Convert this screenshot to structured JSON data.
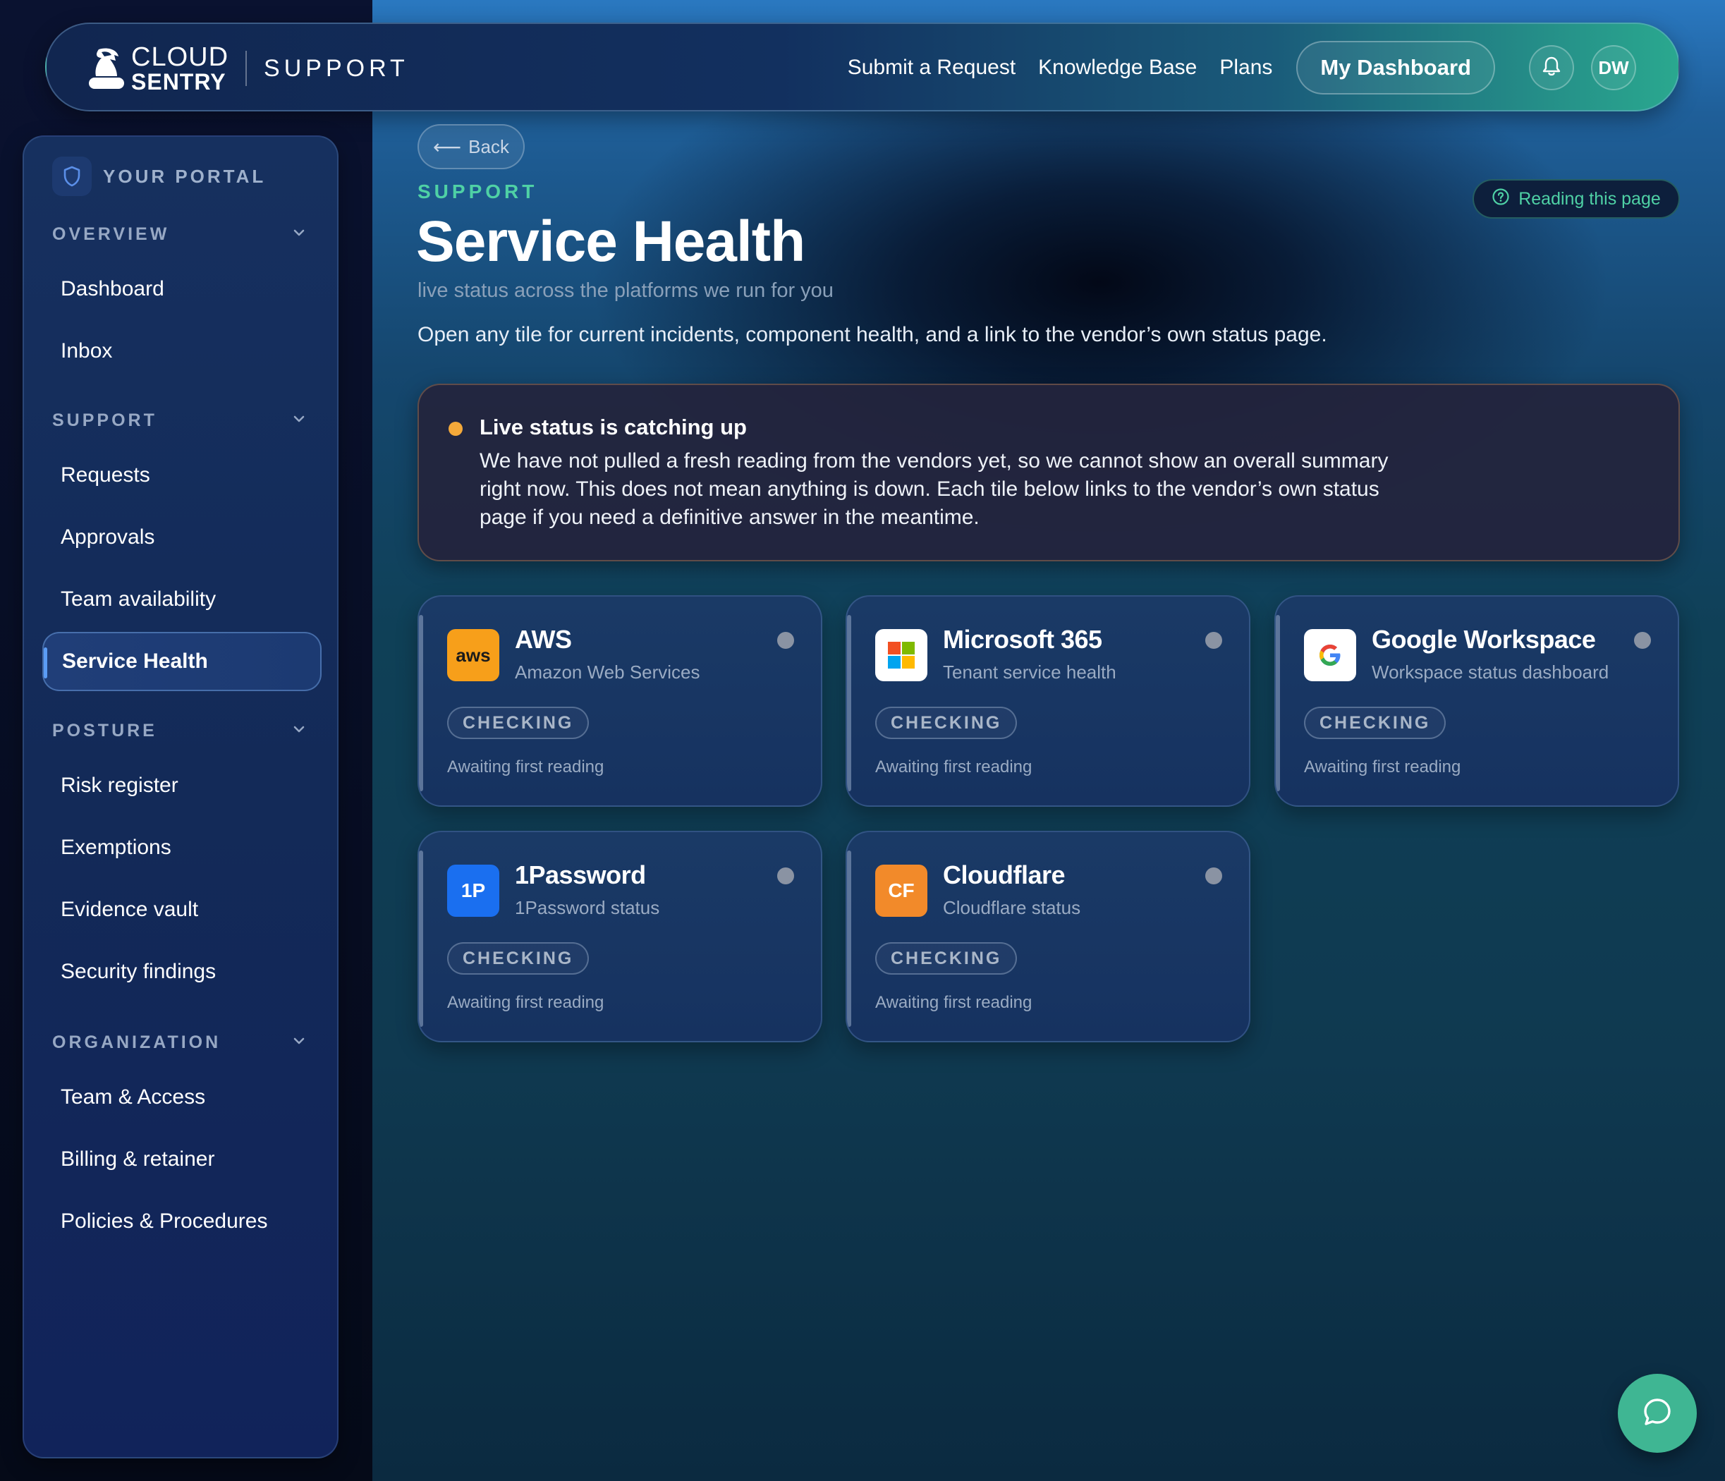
{
  "brand": {
    "name_line1": "CLOUD",
    "name_line2": "SENTRY",
    "section": "SUPPORT",
    "icon": "knight-helmet-icon"
  },
  "topnav": {
    "links": [
      "Submit a Request",
      "Knowledge Base",
      "Plans"
    ],
    "dashboard_button": "My Dashboard",
    "bell_icon": "bell-icon",
    "avatar_initials": "DW"
  },
  "sidebar": {
    "portal_label": "YOUR PORTAL",
    "portal_icon": "shield-icon",
    "sections": [
      {
        "label": "OVERVIEW",
        "items": [
          "Dashboard",
          "Inbox"
        ]
      },
      {
        "label": "SUPPORT",
        "items": [
          "Requests",
          "Approvals",
          "Team availability",
          "Service Health"
        ]
      },
      {
        "label": "POSTURE",
        "items": [
          "Risk register",
          "Exemptions",
          "Evidence vault",
          "Security findings"
        ]
      },
      {
        "label": "ORGANIZATION",
        "items": [
          "Team & Access",
          "Billing & retainer",
          "Policies & Procedures"
        ]
      }
    ],
    "active_item": "Service Health"
  },
  "main": {
    "back_label": "Back",
    "eyebrow": "SUPPORT",
    "title": "Service Health",
    "subtitle": "live status across the platforms we run for you",
    "description": "Open any tile for current incidents, component health, and a link to the vendor’s own status page.",
    "reading_button": "Reading this page"
  },
  "alert": {
    "title": "Live status is catching up",
    "body": "We have not pulled a fresh reading from the vendors yet, so we cannot show an overall summary right now. This does not mean anything is down. Each tile below links to the vendor’s own status page if you need a definitive answer in the meantime.",
    "color": "#f4a93a"
  },
  "tiles": [
    {
      "name": "AWS",
      "subtitle": "Amazon Web Services",
      "badge": "CHECKING",
      "note": "Awaiting first reading",
      "logo_text": "aws",
      "logo_color": "#f79f1a"
    },
    {
      "name": "Microsoft 365",
      "subtitle": "Tenant service health",
      "badge": "CHECKING",
      "note": "Awaiting first reading",
      "logo_text": "",
      "logo_color": "#ffffff"
    },
    {
      "name": "Google Workspace",
      "subtitle": "Workspace status dashboard",
      "badge": "CHECKING",
      "note": "Awaiting first reading",
      "logo_text": "G",
      "logo_color": "#ffffff"
    },
    {
      "name": "1Password",
      "subtitle": "1Password status",
      "badge": "CHECKING",
      "note": "Awaiting first reading",
      "logo_text": "1P",
      "logo_color": "#1a6ff0"
    },
    {
      "name": "Cloudflare",
      "subtitle": "Cloudflare status",
      "badge": "CHECKING",
      "note": "Awaiting first reading",
      "logo_text": "CF",
      "logo_color": "#f28a2a"
    }
  ],
  "chat_icon": "chat-bubble-icon",
  "colors": {
    "accent": "#4fd1a5",
    "status_unknown": "#8a93a3",
    "fab": "#3fb693"
  }
}
